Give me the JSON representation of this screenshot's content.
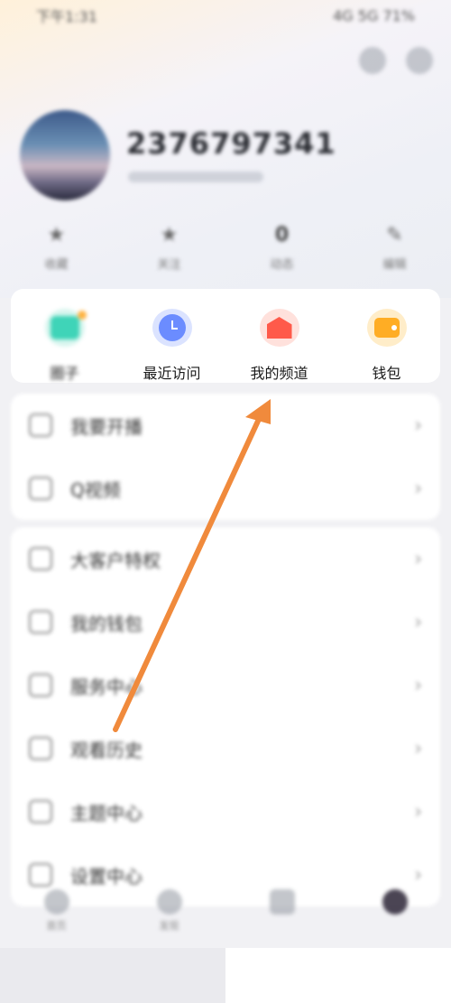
{
  "status_bar": {
    "time": "下午1:31",
    "right": "4G 5G 71%"
  },
  "profile": {
    "username": "2376797341",
    "stats": [
      {
        "glyph": "★",
        "label": "收藏"
      },
      {
        "glyph": "★",
        "label": "关注"
      },
      {
        "value": "0",
        "label": "动态"
      },
      {
        "glyph": "✎",
        "label": "编辑"
      }
    ]
  },
  "quick_actions": [
    {
      "label": "圈子"
    },
    {
      "label": "最近访问"
    },
    {
      "label": "我的频道"
    },
    {
      "label": "钱包"
    }
  ],
  "menu_group_1": [
    {
      "label": "我要开播",
      "chevron": "›"
    },
    {
      "label": "Q视频",
      "chevron": "›"
    }
  ],
  "menu_group_2": [
    {
      "label": "大客户特权",
      "extra": "",
      "chevron": "›"
    },
    {
      "label": "我的钱包",
      "extra": "",
      "chevron": "›"
    },
    {
      "label": "服务中心",
      "extra": "",
      "chevron": "›"
    },
    {
      "label": "观看历史",
      "extra": "",
      "chevron": "›"
    },
    {
      "label": "主题中心",
      "extra": "",
      "chevron": "›"
    },
    {
      "label": "设置中心",
      "extra": "",
      "chevron": "›"
    }
  ],
  "bottom_nav": [
    {
      "label": "首页"
    },
    {
      "label": "发现"
    },
    {
      "label": ""
    },
    {
      "label": ""
    }
  ],
  "colors": {
    "arrow": "#f08a3c"
  }
}
